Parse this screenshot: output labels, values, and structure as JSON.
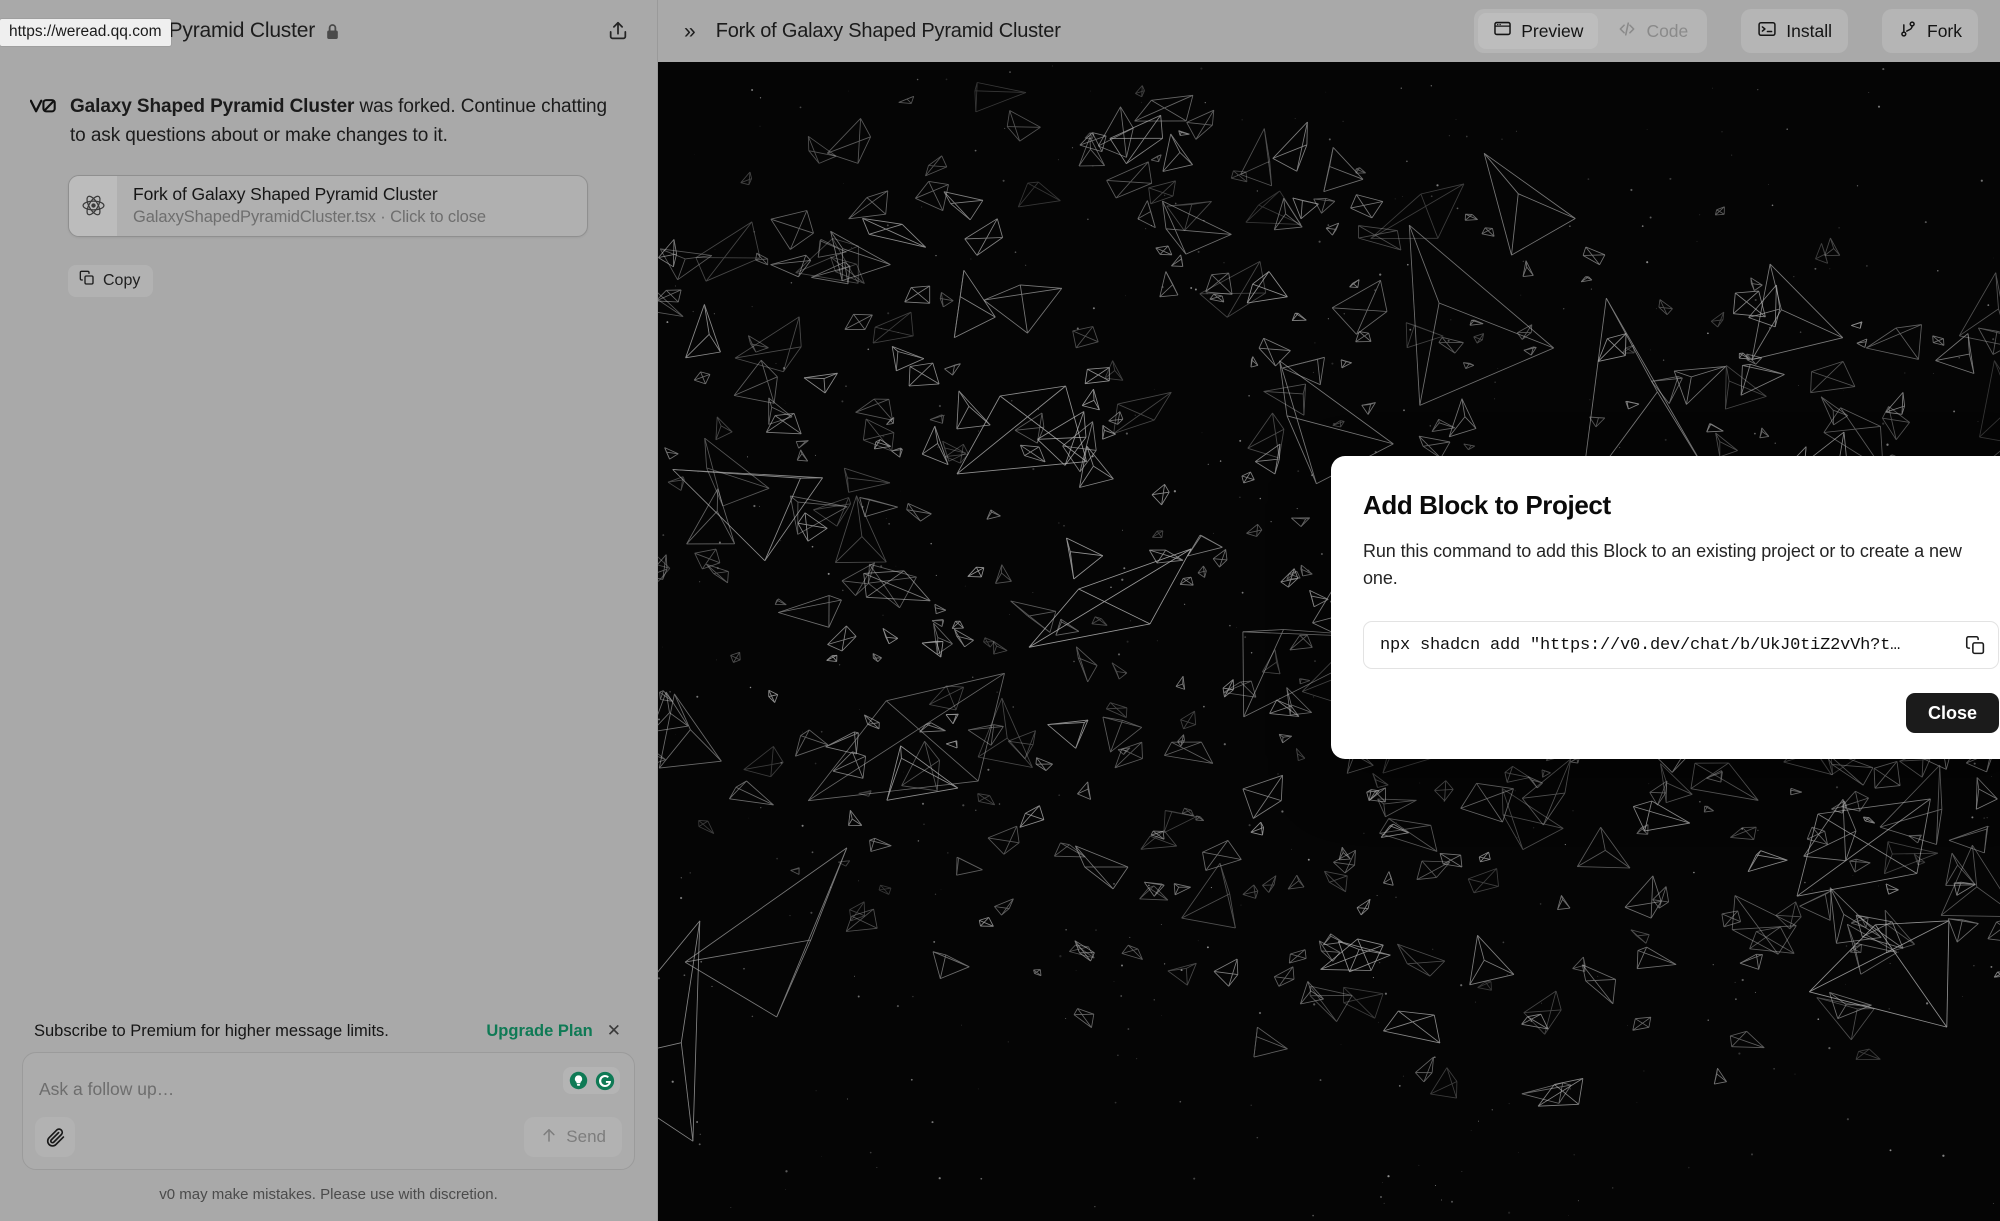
{
  "browser": {
    "status_tooltip_url": "https://weread.qq.com"
  },
  "chat_panel": {
    "header": {
      "title": "Galaxy Shaped Pyramid Cluster",
      "lock_icon": "lock-icon",
      "share_icon": "share-icon"
    },
    "message": {
      "avatar_icon": "v0-logo-icon",
      "bold_prefix": "Galaxy Shaped Pyramid Cluster",
      "rest": " was forked. Continue chatting to ask questions about or make changes to it."
    },
    "block_card": {
      "icon": "react-icon",
      "title": "Fork of Galaxy Shaped Pyramid Cluster",
      "subtitle": "GalaxyShapedPyramidCluster.tsx · Click to close"
    },
    "copy_button": {
      "icon": "copy-icon",
      "label": "Copy"
    },
    "promo": {
      "text": "Subscribe to Premium for higher message limits.",
      "link_label": "Upgrade Plan",
      "close_icon": "close-icon",
      "link_color": "#0f7a55"
    },
    "composer": {
      "placeholder": "Ask a follow up…",
      "attach_icon": "paperclip-icon",
      "send_label": "Send",
      "send_icon": "arrow-up-icon",
      "grammarly_icons": [
        "lightbulb-icon",
        "grammarly-g-icon"
      ],
      "grammarly_color": "#0f7a55"
    },
    "disclaimer": "v0 may make mistakes. Please use with discretion."
  },
  "preview_pane": {
    "collapse_icon": "chevrons-right-icon",
    "title": "Fork of Galaxy Shaped Pyramid Cluster",
    "tabs": [
      {
        "label": "Preview",
        "icon": "window-icon",
        "active": true
      },
      {
        "label": "Code",
        "icon": "code-brackets-icon",
        "active": false
      }
    ],
    "actions": [
      {
        "label": "Install",
        "icon": "terminal-icon"
      },
      {
        "label": "Fork",
        "icon": "git-branch-icon"
      }
    ],
    "canvas": {
      "background_color": "#050505",
      "wireframe_color": "#b9b9b9",
      "description": "Galaxy shaped cluster of wireframe pyramids on black starfield"
    }
  },
  "modal": {
    "title": "Add Block to Project",
    "description": "Run this command to add this Block to an existing project or to create a new one.",
    "command": "npx shadcn add \"https://v0.dev/chat/b/UkJ0tiZ2vVh?t…",
    "command_copy_icon": "copy-icon",
    "close_label": "Close",
    "close_bg": "#1b1b1b"
  }
}
